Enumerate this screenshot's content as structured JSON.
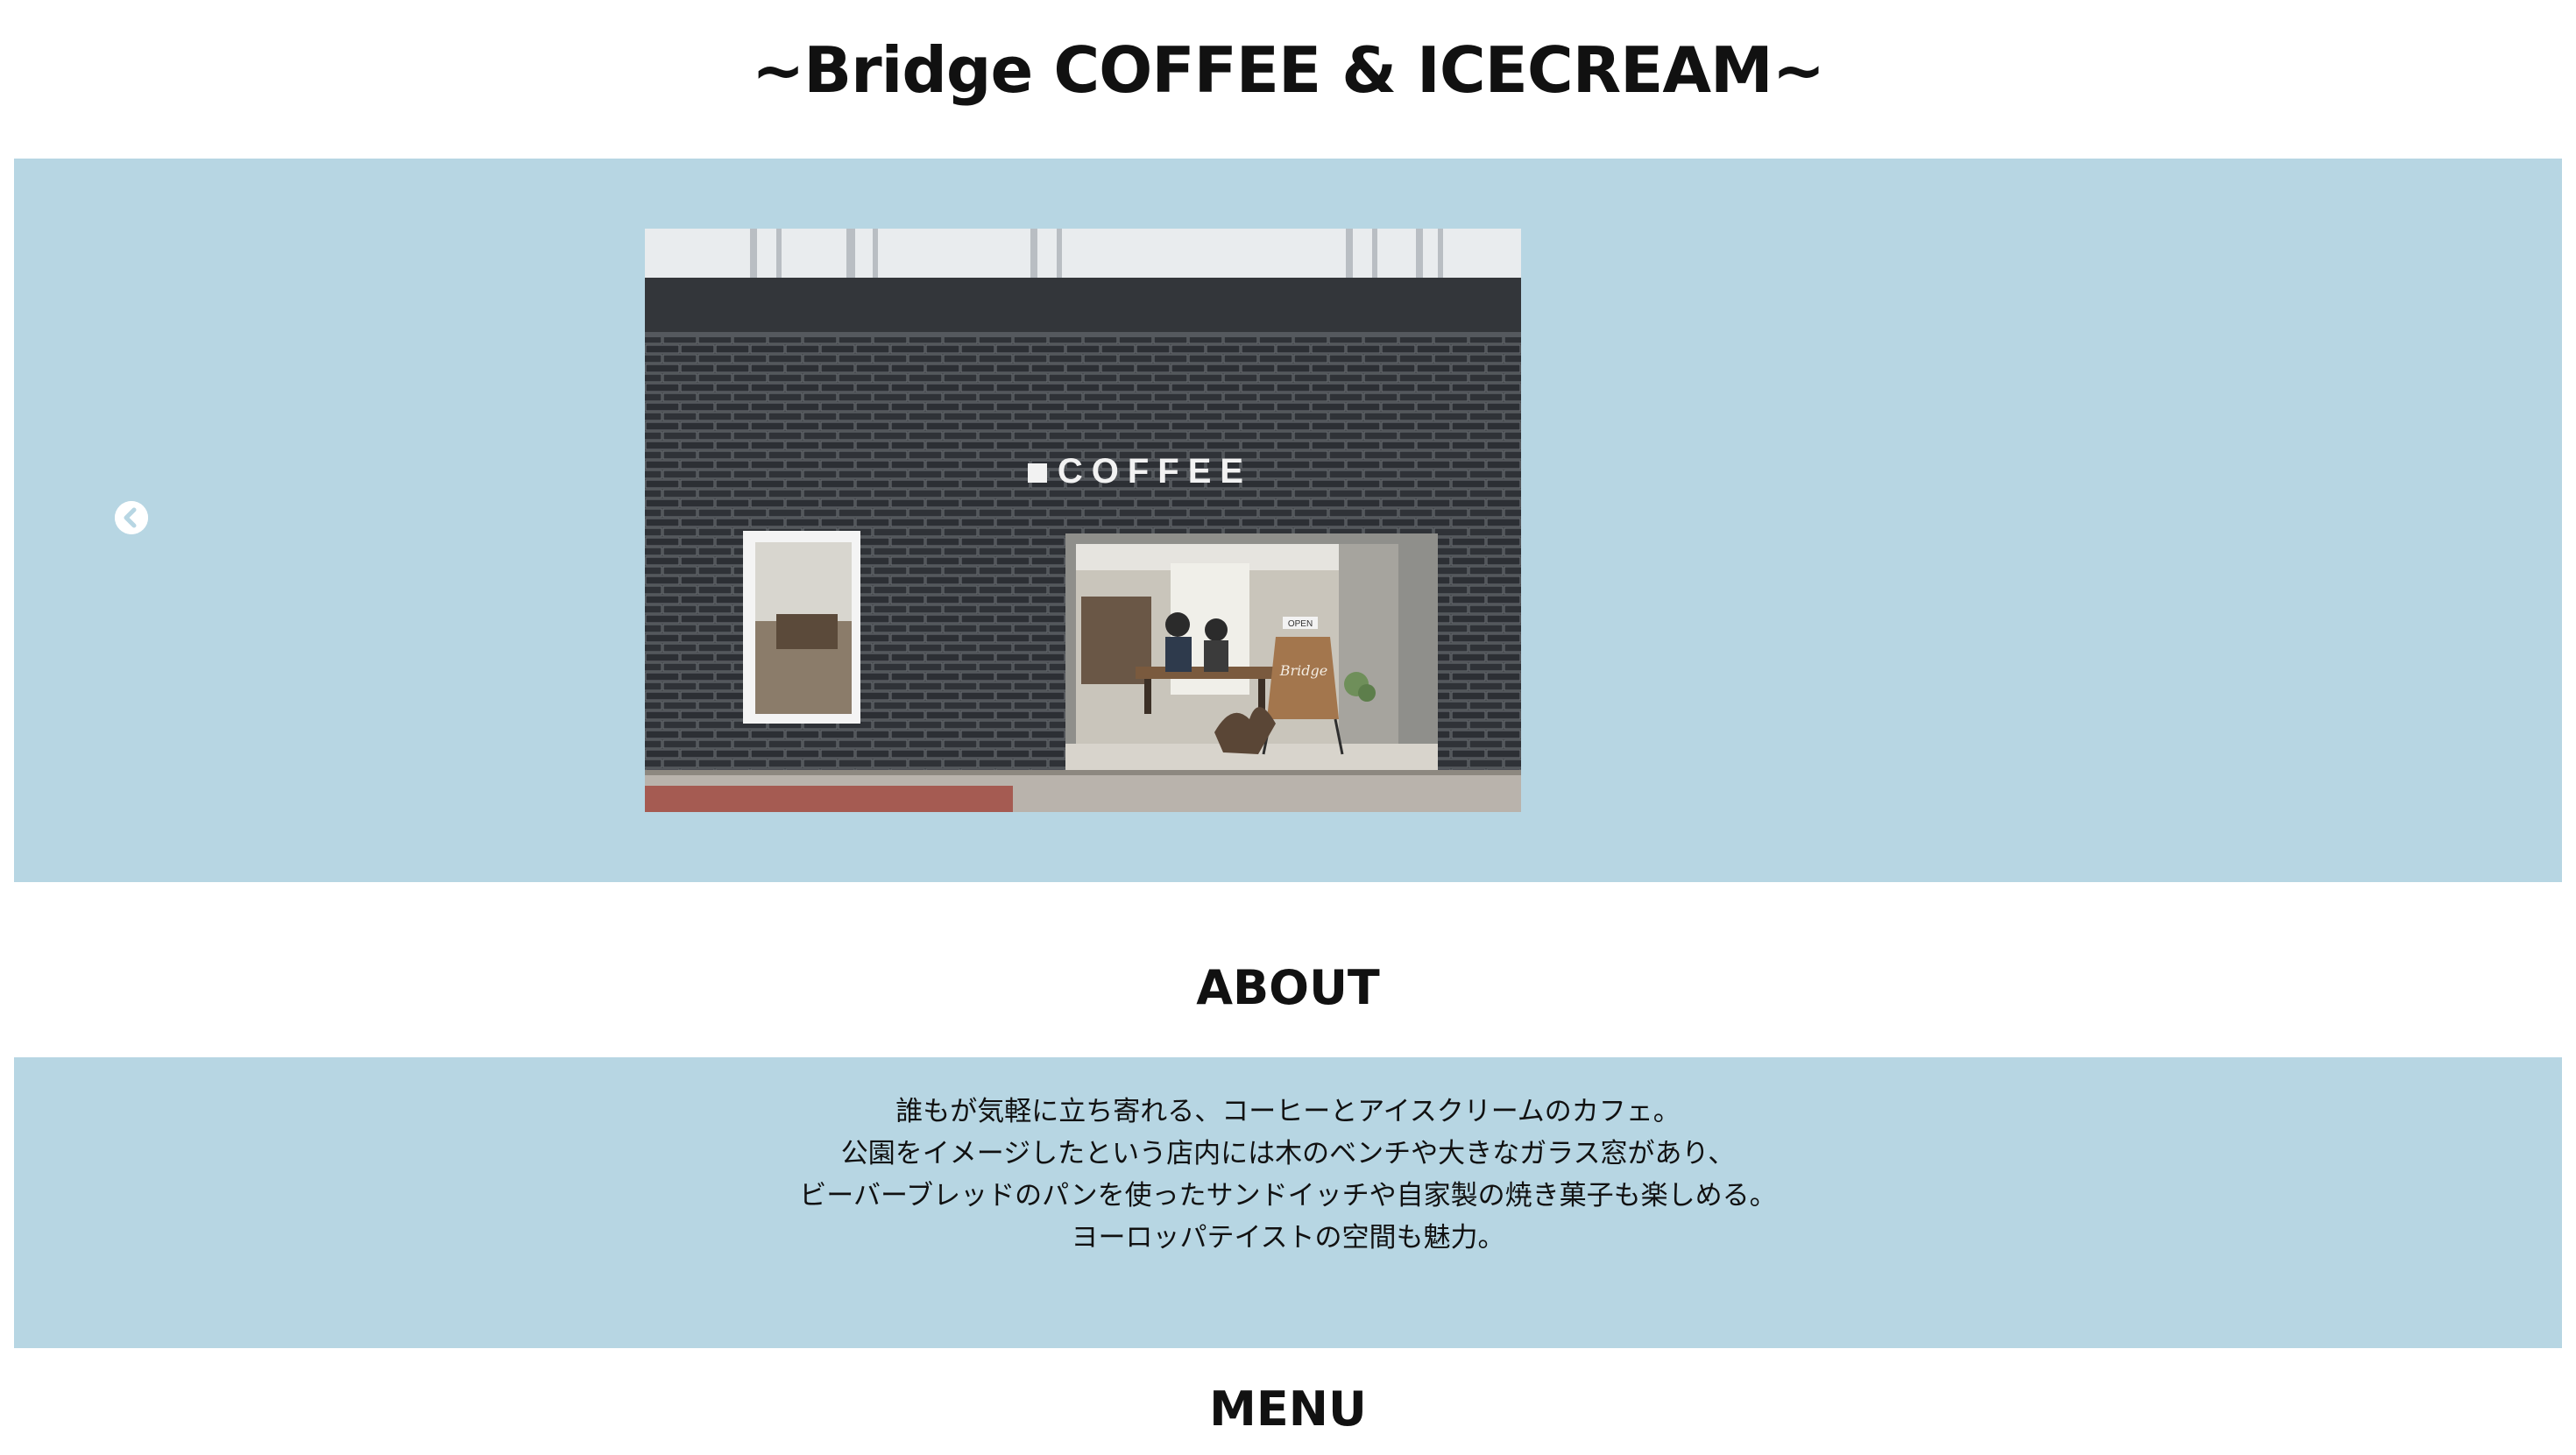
{
  "header": {
    "title": "~Bridge COFFEE & ICECREAM~"
  },
  "hero": {
    "background_color": "#b7d6e3",
    "prev_icon": "chevron-left-circle-icon",
    "photo": {
      "description_icon": "storefront-photo",
      "sign_text": "COFFEE",
      "open_sign_text": "OPEN",
      "board_text": "Bridge"
    }
  },
  "about": {
    "title": "ABOUT",
    "lines": [
      "誰もが気軽に立ち寄れる、コーヒーとアイスクリームのカフェ。",
      "公園をイメージしたという店内には木のベンチや大きなガラス窓があり、",
      "ビーバーブレッドのパンを使ったサンドイッチや自家製の焼き菓子も楽しめる。",
      "ヨーロッパテイストの空間も魅力。"
    ]
  },
  "menu": {
    "title": "MENU"
  }
}
